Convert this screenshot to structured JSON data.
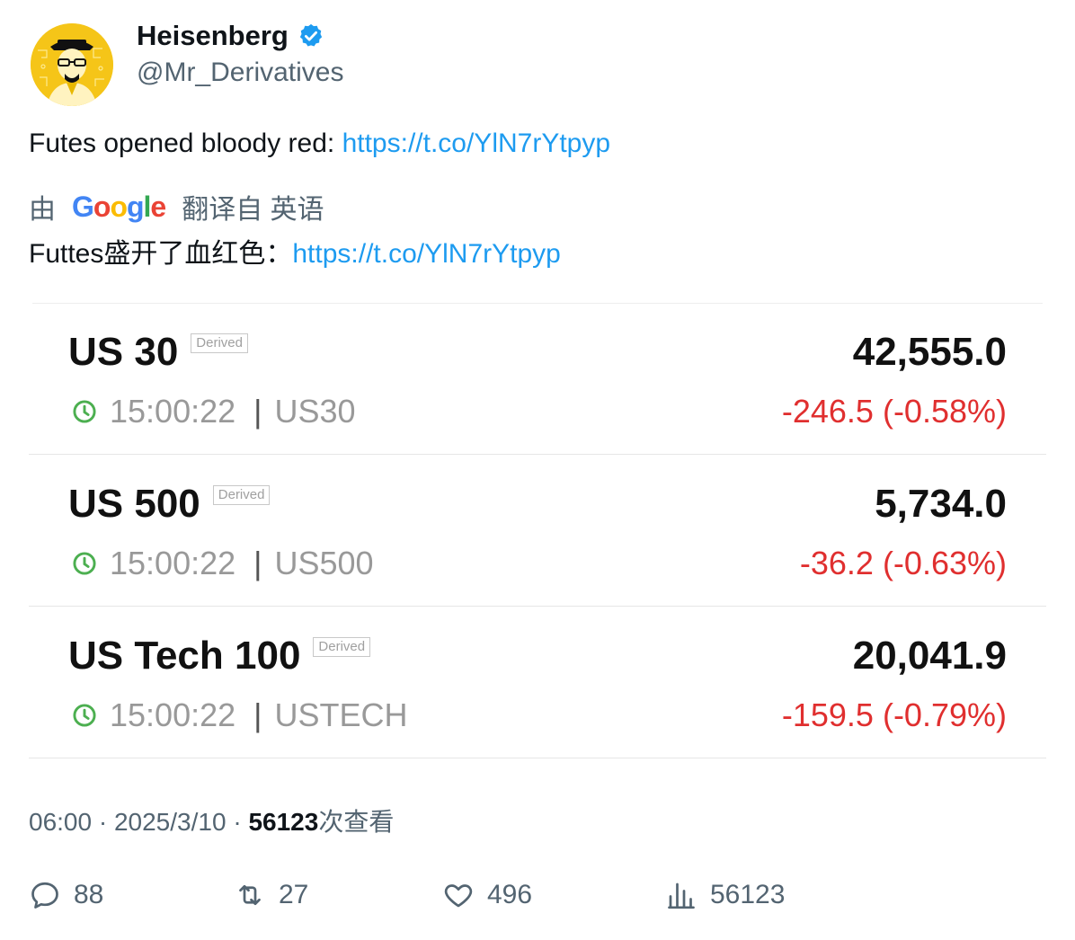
{
  "author": {
    "name": "Heisenberg",
    "handle": "@Mr_Derivatives",
    "verified_icon": "verified-badge-icon",
    "badge_color": "#1d9bf0"
  },
  "tweet": {
    "text_prefix": "Futes opened bloody red: ",
    "link": "https://t.co/YlN7rYtpyp",
    "translation": {
      "by_label": "由",
      "provider": "Google",
      "from_label": "翻译自 英语",
      "text_prefix": "Futtes盛开了血红色：",
      "link": "https://t.co/YlN7rYtpyp"
    }
  },
  "card": {
    "rows": [
      {
        "symbol": "US 30",
        "badge": "Derived",
        "price": "42,555.0",
        "time": "15:00:22",
        "code": "US30",
        "change": "-246.5 (-0.58%)"
      },
      {
        "symbol": "US 500",
        "badge": "Derived",
        "price": "5,734.0",
        "time": "15:00:22",
        "code": "US500",
        "change": "-36.2 (-0.63%)"
      },
      {
        "symbol": "US Tech 100",
        "badge": "Derived",
        "price": "20,041.9",
        "time": "15:00:22",
        "code": "USTECH",
        "change": "-159.5 (-0.79%)"
      }
    ],
    "separator": "|",
    "negative_color": "#e02f2f",
    "clock_color": "#4caf50"
  },
  "meta": {
    "time": "06:00",
    "dot": "·",
    "date": "2025/3/10",
    "views": "56123",
    "views_label": "次查看"
  },
  "actions": {
    "replies": "88",
    "retweets": "27",
    "likes": "496",
    "views": "56123"
  }
}
